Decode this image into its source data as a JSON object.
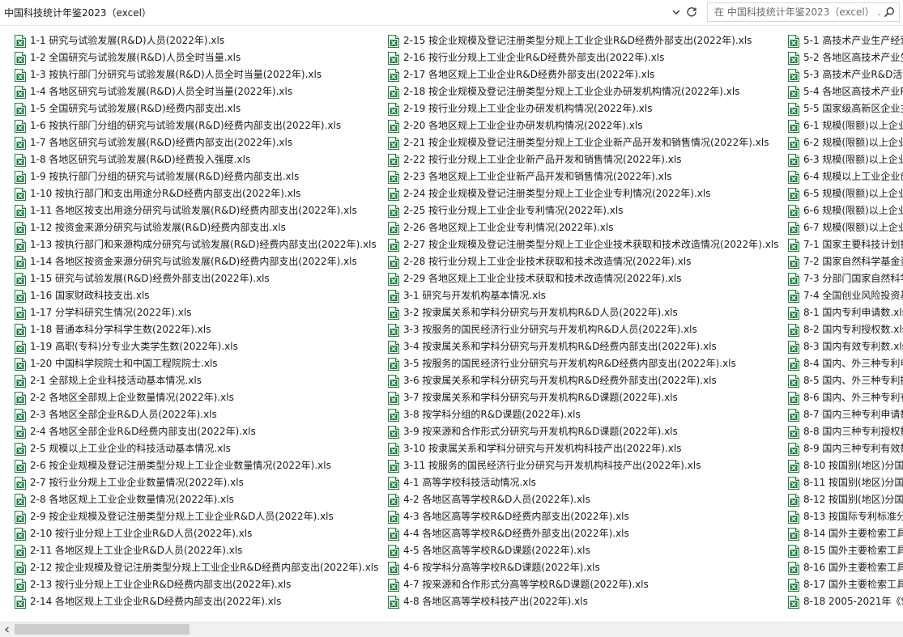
{
  "address": {
    "path": "中国科技统计年鉴2023（excel）",
    "search_placeholder": "在 中国科技统计年鉴2023（excel） ..."
  },
  "icons": {
    "file": "excel-file-icon",
    "dropdown": "chevron-down-icon",
    "refresh": "refresh-icon",
    "search": "search-icon",
    "scroll_left": "arrow-left-icon"
  },
  "colors": {
    "excel_green": "#1e7a3f",
    "scroll_thumb": "#cdcdcd"
  },
  "files": {
    "col1": [
      "1-1 研究与试验发展(R&D)人员(2022年).xls",
      "1-2 全国研究与试验发展(R&D)人员全时当量.xls",
      "1-3 按执行部门分研究与试验发展(R&D)人员全时当量(2022年).xls",
      "1-4 各地区研究与试验发展(R&D)人员全时当量(2022年).xls",
      "1-5 全国研究与试验发展(R&D)经费内部支出.xls",
      "1-6 按执行部门分组的研究与试验发展(R&D)经费内部支出(2022年).xls",
      "1-7 各地区研究与试验发展(R&D)经费内部支出(2022年).xls",
      "1-8 各地区研究与试验发展(R&D)经费投入强度.xls",
      "1-9 按执行部门分组的研究与试验发展(R&D)经费内部支出.xls",
      "1-10 按执行部门和支出用途分R&D经费内部支出(2022年).xls",
      "1-11 各地区按支出用途分研究与试验发展(R&D)经费内部支出(2022年).xls",
      "1-12 按资金来源分研究与试验发展(R&D)经费内部支出.xls",
      "1-13 按执行部门和来源构成分研究与试验发展(R&D)经费内部支出(2022年).xls",
      "1-14 各地区按资金来源分研究与试验发展(R&D)经费内部支出(2022年).xls",
      "1-15 研究与试验发展(R&D)经费外部支出(2022年).xls",
      "1-16 国家财政科技支出.xls",
      "1-17 分学科研究生情况(2022年).xls",
      "1-18 普通本科分学科学生数(2022年).xls",
      "1-19 高职(专科)分专业大类学生数(2022年).xls",
      "1-20 中国科学院院士和中国工程院院士.xls",
      "2-1 全部规上企业科技活动基本情况.xls",
      "2-2 各地区全部规上企业数量情况(2022年).xls",
      "2-3 各地区全部企业R&D人员(2022年).xls",
      "2-4 各地区全部企业R&D经费内部支出(2022年).xls",
      "2-5 规模以上工业企业的科技活动基本情况.xls",
      "2-6 按企业规模及登记注册类型分规上工业企业数量情况(2022年).xls",
      "2-7 按行业分规上工业企业数量情况(2022年).xls",
      "2-8 各地区规上工业企业数量情况(2022年).xls",
      "2-9 按企业规模及登记注册类型分规上工业企业R&D人员(2022年).xls",
      "2-10 按行业分规上工业企业R&D人员(2022年).xls",
      "2-11 各地区规上工业企业R&D人员(2022年).xls",
      "2-12 按企业规模及登记注册类型分规上工业企业R&D经费内部支出(2022年).xls",
      "2-13 按行业分规上工业企业R&D经费内部支出(2022年).xls",
      "2-14 各地区规上工业企业R&D经费内部支出(2022年).xls"
    ],
    "col2": [
      "2-15 按企业规模及登记注册类型分规上工业企业R&D经费外部支出(2022年).xls",
      "2-16 按行业分规上工业企业R&D经费外部支出(2022年).xls",
      "2-17 各地区规上工业企业R&D经费外部支出(2022年).xls",
      "2-18 按企业规模及登记注册类型分规上工业企业办研发机构情况(2022年).xls",
      "2-19 按行业分规上工业企业办研发机构情况(2022年).xls",
      "2-20 各地区规上工业企业办研发机构情况(2022年).xls",
      "2-21 按企业规模及登记注册类型分规上工业企业新产品开发和销售情况(2022年).xls",
      "2-22 按行业分规上工业企业新产品开发和销售情况(2022年).xls",
      "2-23 各地区规上工业企业新产品开发和销售情况(2022年).xls",
      "2-24 按企业规模及登记注册类型分规上工业企业专利情况(2022年).xls",
      "2-25 按行业分规上工业企业专利情况(2022年).xls",
      "2-26 各地区规上工业企业专利情况(2022年).xls",
      "2-27 按企业规模及登记注册类型分规上工业企业技术获取和技术改造情况(2022年).xls",
      "2-28 按行业分规上工业企业技术获取和技术改造情况(2022年).xls",
      "2-29 各地区规上工业企业技术获取和技术改造情况(2022年).xls",
      "3-1 研究与开发机构基本情况.xls",
      "3-2 按隶属关系和学科分研究与开发机构R&D人员(2022年).xls",
      "3-3 按服务的国民经济行业分研究与开发机构R&D人员(2022年).xls",
      "3-4 按隶属关系和学科分研究与开发机构R&D经费内部支出(2022年).xls",
      "3-5 按服务的国民经济行业分研究与开发机构R&D经费内部支出(2022年).xls",
      "3-6 按隶属关系和学科分研究与开发机构R&D经费外部支出(2022年).xls",
      "3-7 按隶属关系和学科分研究与开发机构R&D课题(2022年).xls",
      "3-8 按学科分组的R&D课题(2022年).xls",
      "3-9 按来源和合作形式分研究与开发机构R&D课题(2022年).xls",
      "3-10 按隶属关系和学科分研究与开发机构科技产出(2022年).xls",
      "3-11 按服务的国民经济行业分研究与开发机构科技产出(2022年).xls",
      "4-1 高等学校科技活动情况.xls",
      "4-2 各地区高等学校R&D人员(2022年).xls",
      "4-3 各地区高等学校R&D经费内部支出(2022年).xls",
      "4-4 各地区高等学校R&D经费外部支出(2022年).xls",
      "4-5 各地区高等学校R&D课题(2022年).xls",
      "4-6 按学科分高等学校R&D课题(2022年).xls",
      "4-7 按来源和合作形式分高等学校R&D课题(2022年).xls",
      "4-8 各地区高等学校科技产出(2022年).xls"
    ],
    "col3": [
      "5-1 高技术产业生产经营",
      "5-2 各地区高技术产业生",
      "5-3 高技术产业R&D活",
      "5-4 各地区高技术产业R",
      "5-5 国家级高新区企业主",
      "6-1 规模(限额)以上企业",
      "6-2 规模(限额)以上企业",
      "6-3 规模(限额)以上企业",
      "6-4 规模以上工业企业创",
      "6-5 规模(限额)以上企业",
      "6-6 规模(限额)以上企业",
      "6-7 规模(限额)以上企业",
      "7-1 国家主要科技计划投",
      "7-2 国家自然科学基金资",
      "7-3 分部门国家自然科学",
      "7-4 全国创业风险投资基",
      "8-1 国内专利申请数.xls",
      "8-2 国内专利授权数.xls",
      "8-3 国内有效专利数.xls",
      "8-4 国内、外三种专利申",
      "8-5 国内、外三种专利授",
      "8-6 国内、外三种专利有",
      "8-7 国内三种专利申请数",
      "8-8 国内三种专利授权数",
      "8-9 国内三种专利有效数",
      "8-10 按国别(地区)分国",
      "8-11 按国别(地区)分国",
      "8-12 按国别(地区)分国",
      "8-13 按国际专利标准分",
      "8-14 国外主要检索工具",
      "8-15 国外主要检索工具",
      "8-16 国外主要检索工具",
      "8-17 国外主要检索工具",
      "8-18 2005-2021年《S"
    ]
  }
}
